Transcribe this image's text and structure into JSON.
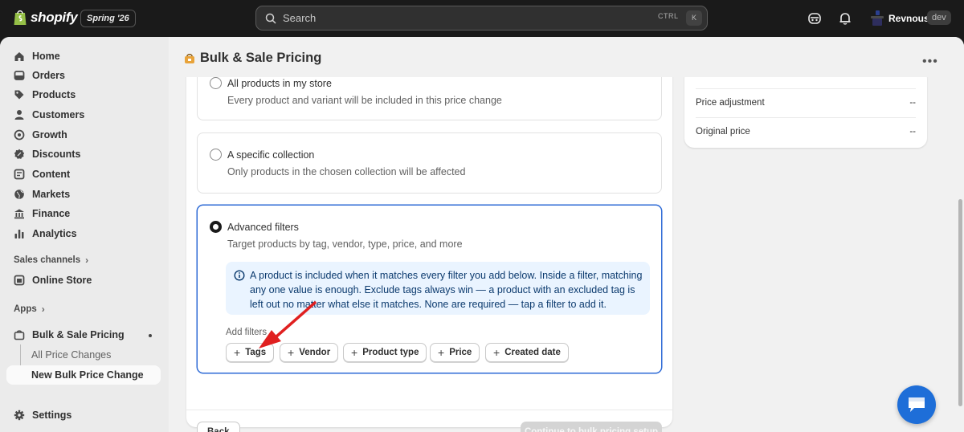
{
  "topbar": {
    "logo_text": "shopify",
    "edition": "Spring '26",
    "search_placeholder": "Search",
    "shortcut_ctrl": "CTRL",
    "shortcut_key": "K",
    "store_name": "Revnous",
    "store_badge": "dev"
  },
  "sidebar": {
    "items": [
      {
        "label": "Home",
        "icon": "home-icon"
      },
      {
        "label": "Orders",
        "icon": "orders-icon"
      },
      {
        "label": "Products",
        "icon": "tag-icon"
      },
      {
        "label": "Customers",
        "icon": "person-icon"
      },
      {
        "label": "Growth",
        "icon": "growth-icon"
      },
      {
        "label": "Discounts",
        "icon": "discount-icon"
      },
      {
        "label": "Content",
        "icon": "content-icon"
      },
      {
        "label": "Markets",
        "icon": "globe-icon"
      },
      {
        "label": "Finance",
        "icon": "bank-icon"
      },
      {
        "label": "Analytics",
        "icon": "bar-chart-icon"
      }
    ],
    "sales_channels_label": "Sales channels",
    "online_store_label": "Online Store",
    "apps_label": "Apps",
    "app_name": "Bulk & Sale Pricing",
    "app_sub_items": [
      "All Price Changes",
      "New Bulk Price Change"
    ],
    "settings_label": "Settings"
  },
  "page": {
    "title": "Bulk & Sale Pricing",
    "options": [
      {
        "title": "All products in my store",
        "description": "Every product and variant will be included in this price change",
        "selected": false
      },
      {
        "title": "A specific collection",
        "description": "Only products in the chosen collection will be affected",
        "selected": false
      },
      {
        "title": "Advanced filters",
        "description": "Target products by tag, vendor, type, price, and more",
        "selected": true
      }
    ],
    "info_text": "A product is included when it matches every filter you add below. Inside a filter, matching any one value is enough. Exclude tags always win — a product with an excluded tag is left out no matter what else it matches. None are required — tap a filter to add it.",
    "add_filters_label": "Add filters",
    "filter_chips": [
      "Tags",
      "Vendor",
      "Product type",
      "Price",
      "Created date"
    ],
    "back_label": "Back",
    "continue_label": "Continue to bulk pricing setup"
  },
  "summary": {
    "rows": [
      {
        "label": "Price adjustment",
        "value": "--"
      },
      {
        "label": "Original price",
        "value": "--"
      }
    ]
  },
  "colors": {
    "accent": "#2d6ad6",
    "info_bg": "#eaf4ff",
    "annotation_arrow": "#e02020",
    "chat_button": "#1e6ed8"
  }
}
